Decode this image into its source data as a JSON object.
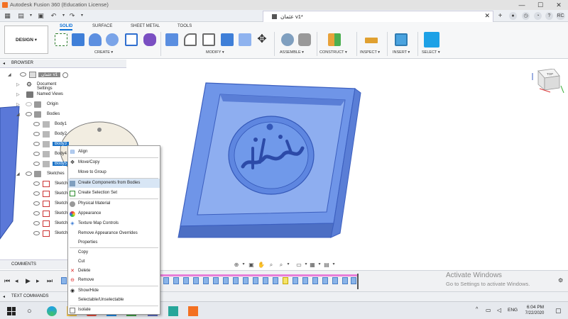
{
  "window": {
    "title": "Autodesk Fusion 360 (Education License)",
    "minimize": "—",
    "maximize": "☐",
    "close": "✕"
  },
  "tab": {
    "document_title": "عثمان v1*",
    "close": "✕",
    "user_initials": "RC"
  },
  "ribbon": {
    "workspace_label": "DESIGN ▾",
    "tabs": [
      "SOLID",
      "SURFACE",
      "SHEET METAL",
      "TOOLS"
    ],
    "groups": [
      "CREATE ▾",
      "MODIFY ▾",
      "ASSEMBLE ▾",
      "CONSTRUCT ▾",
      "INSPECT ▾",
      "INSERT ▾",
      "SELECT ▾"
    ]
  },
  "browser": {
    "header": "BROWSER",
    "items": [
      {
        "label": "عثمان v1"
      },
      {
        "label": "Document Settings"
      },
      {
        "label": "Named Views"
      },
      {
        "label": "Origin"
      },
      {
        "label": "Bodies"
      },
      {
        "label": "Body1"
      },
      {
        "label": "Body2"
      },
      {
        "label": "Body3"
      },
      {
        "label": "Body4"
      },
      {
        "label": "Body5"
      },
      {
        "label": "Sketches"
      },
      {
        "label": "Sketch1"
      },
      {
        "label": "Sketch2"
      },
      {
        "label": "Sketch3"
      },
      {
        "label": "Sketch4"
      },
      {
        "label": "Sketch5"
      },
      {
        "label": "Sketch6"
      }
    ]
  },
  "context_menu": {
    "items": [
      "Align",
      "Move/Copy",
      "Move to Group",
      "Create Components from Bodies",
      "Create Selection Set",
      "Physical Material",
      "Appearance",
      "Texture Map Controls",
      "Remove Appearance Overrides",
      "Properties",
      "Copy",
      "Cut",
      "Delete",
      "Remove",
      "Show/Hide",
      "Selectable/Unselectable",
      "Isolate"
    ]
  },
  "panels": {
    "comments": "COMMENTS",
    "text_commands": "TEXT COMMANDS"
  },
  "watermark": {
    "line1": "Activate Windows",
    "line2": "Go to Settings to activate Windows."
  },
  "viewcube": {
    "label": "TOP"
  },
  "tray": {
    "lang": "ENG",
    "time": "6:04 PM",
    "date": "7/22/2020"
  },
  "colors": {
    "model_blue": "#6f95e8",
    "model_dark": "#4d6fc4",
    "selection": "#1d74c9",
    "accent_orange": "#f37021"
  }
}
